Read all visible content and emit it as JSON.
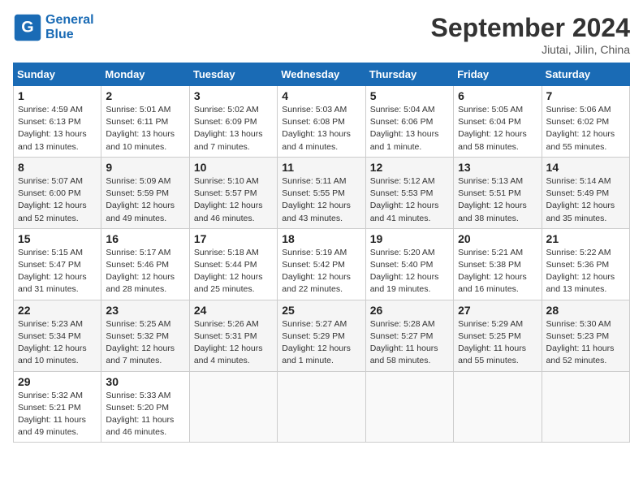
{
  "header": {
    "logo_line1": "General",
    "logo_line2": "Blue",
    "month": "September 2024",
    "location": "Jiutai, Jilin, China"
  },
  "weekdays": [
    "Sunday",
    "Monday",
    "Tuesday",
    "Wednesday",
    "Thursday",
    "Friday",
    "Saturday"
  ],
  "weeks": [
    [
      {
        "day": "1",
        "info": "Sunrise: 4:59 AM\nSunset: 6:13 PM\nDaylight: 13 hours\nand 13 minutes."
      },
      {
        "day": "2",
        "info": "Sunrise: 5:01 AM\nSunset: 6:11 PM\nDaylight: 13 hours\nand 10 minutes."
      },
      {
        "day": "3",
        "info": "Sunrise: 5:02 AM\nSunset: 6:09 PM\nDaylight: 13 hours\nand 7 minutes."
      },
      {
        "day": "4",
        "info": "Sunrise: 5:03 AM\nSunset: 6:08 PM\nDaylight: 13 hours\nand 4 minutes."
      },
      {
        "day": "5",
        "info": "Sunrise: 5:04 AM\nSunset: 6:06 PM\nDaylight: 13 hours\nand 1 minute."
      },
      {
        "day": "6",
        "info": "Sunrise: 5:05 AM\nSunset: 6:04 PM\nDaylight: 12 hours\nand 58 minutes."
      },
      {
        "day": "7",
        "info": "Sunrise: 5:06 AM\nSunset: 6:02 PM\nDaylight: 12 hours\nand 55 minutes."
      }
    ],
    [
      {
        "day": "8",
        "info": "Sunrise: 5:07 AM\nSunset: 6:00 PM\nDaylight: 12 hours\nand 52 minutes."
      },
      {
        "day": "9",
        "info": "Sunrise: 5:09 AM\nSunset: 5:59 PM\nDaylight: 12 hours\nand 49 minutes."
      },
      {
        "day": "10",
        "info": "Sunrise: 5:10 AM\nSunset: 5:57 PM\nDaylight: 12 hours\nand 46 minutes."
      },
      {
        "day": "11",
        "info": "Sunrise: 5:11 AM\nSunset: 5:55 PM\nDaylight: 12 hours\nand 43 minutes."
      },
      {
        "day": "12",
        "info": "Sunrise: 5:12 AM\nSunset: 5:53 PM\nDaylight: 12 hours\nand 41 minutes."
      },
      {
        "day": "13",
        "info": "Sunrise: 5:13 AM\nSunset: 5:51 PM\nDaylight: 12 hours\nand 38 minutes."
      },
      {
        "day": "14",
        "info": "Sunrise: 5:14 AM\nSunset: 5:49 PM\nDaylight: 12 hours\nand 35 minutes."
      }
    ],
    [
      {
        "day": "15",
        "info": "Sunrise: 5:15 AM\nSunset: 5:47 PM\nDaylight: 12 hours\nand 31 minutes."
      },
      {
        "day": "16",
        "info": "Sunrise: 5:17 AM\nSunset: 5:46 PM\nDaylight: 12 hours\nand 28 minutes."
      },
      {
        "day": "17",
        "info": "Sunrise: 5:18 AM\nSunset: 5:44 PM\nDaylight: 12 hours\nand 25 minutes."
      },
      {
        "day": "18",
        "info": "Sunrise: 5:19 AM\nSunset: 5:42 PM\nDaylight: 12 hours\nand 22 minutes."
      },
      {
        "day": "19",
        "info": "Sunrise: 5:20 AM\nSunset: 5:40 PM\nDaylight: 12 hours\nand 19 minutes."
      },
      {
        "day": "20",
        "info": "Sunrise: 5:21 AM\nSunset: 5:38 PM\nDaylight: 12 hours\nand 16 minutes."
      },
      {
        "day": "21",
        "info": "Sunrise: 5:22 AM\nSunset: 5:36 PM\nDaylight: 12 hours\nand 13 minutes."
      }
    ],
    [
      {
        "day": "22",
        "info": "Sunrise: 5:23 AM\nSunset: 5:34 PM\nDaylight: 12 hours\nand 10 minutes."
      },
      {
        "day": "23",
        "info": "Sunrise: 5:25 AM\nSunset: 5:32 PM\nDaylight: 12 hours\nand 7 minutes."
      },
      {
        "day": "24",
        "info": "Sunrise: 5:26 AM\nSunset: 5:31 PM\nDaylight: 12 hours\nand 4 minutes."
      },
      {
        "day": "25",
        "info": "Sunrise: 5:27 AM\nSunset: 5:29 PM\nDaylight: 12 hours\nand 1 minute."
      },
      {
        "day": "26",
        "info": "Sunrise: 5:28 AM\nSunset: 5:27 PM\nDaylight: 11 hours\nand 58 minutes."
      },
      {
        "day": "27",
        "info": "Sunrise: 5:29 AM\nSunset: 5:25 PM\nDaylight: 11 hours\nand 55 minutes."
      },
      {
        "day": "28",
        "info": "Sunrise: 5:30 AM\nSunset: 5:23 PM\nDaylight: 11 hours\nand 52 minutes."
      }
    ],
    [
      {
        "day": "29",
        "info": "Sunrise: 5:32 AM\nSunset: 5:21 PM\nDaylight: 11 hours\nand 49 minutes."
      },
      {
        "day": "30",
        "info": "Sunrise: 5:33 AM\nSunset: 5:20 PM\nDaylight: 11 hours\nand 46 minutes."
      },
      {
        "day": "",
        "info": ""
      },
      {
        "day": "",
        "info": ""
      },
      {
        "day": "",
        "info": ""
      },
      {
        "day": "",
        "info": ""
      },
      {
        "day": "",
        "info": ""
      }
    ]
  ]
}
